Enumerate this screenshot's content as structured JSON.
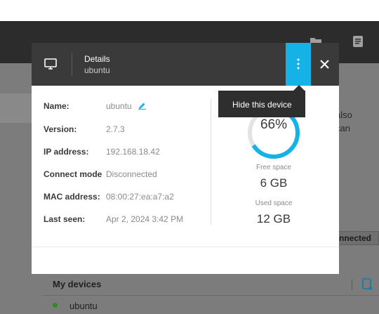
{
  "background": {
    "partial_text_1": "also",
    "partial_text_2": "can",
    "status_chip": "nnected",
    "my_devices_heading": "My devices",
    "device_list": [
      {
        "name": "ubuntu",
        "status_color": "#2f8c1f"
      }
    ],
    "toolbar_icons": [
      "folder-icon",
      "document-icon"
    ]
  },
  "dialog": {
    "title": "Details",
    "subtitle": "ubuntu",
    "more_button_color": "#14b2e6",
    "fields": [
      {
        "label": "Name:",
        "value": "ubuntu"
      },
      {
        "label": "Version:",
        "value": "2.7.3"
      },
      {
        "label": "IP address:",
        "value": "192.168.18.42"
      },
      {
        "label": "Connect mode",
        "value": "Disconnected"
      },
      {
        "label": "MAC address:",
        "value": "08:00:27:ea:a7:a2"
      },
      {
        "label": "Last seen:",
        "value": "Apr 2, 2024 3:42 PM"
      }
    ],
    "storage": {
      "used_percent_label": "66%",
      "used_fraction": 0.66,
      "free_space_label": "Free space",
      "free_space_value": "6 GB",
      "used_space_label": "Used space",
      "used_space_value": "12 GB"
    }
  },
  "tooltip": {
    "text": "Hide this device"
  },
  "colors": {
    "accent": "#14b2e6",
    "header": "#3a3a3a",
    "online": "#2f8c1f"
  }
}
